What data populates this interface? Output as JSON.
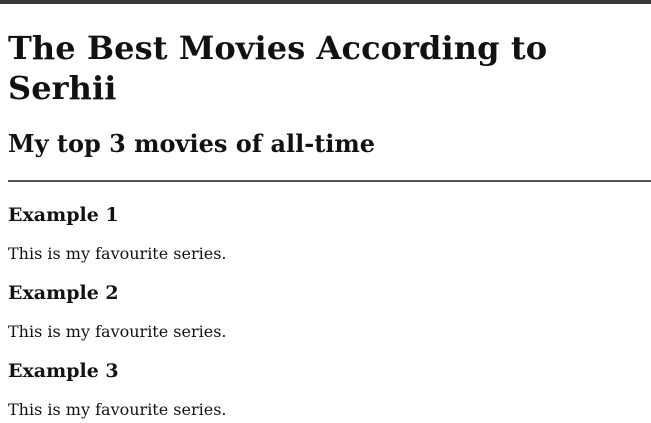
{
  "header": {
    "title": "The Best Movies According to Serhii",
    "subtitle": "My top 3 movies of all-time"
  },
  "movies": [
    {
      "title": "Example 1",
      "description": "This is my favourite series."
    },
    {
      "title": "Example 2",
      "description": "This is my favourite series."
    },
    {
      "title": "Example 3",
      "description": "This is my favourite series."
    }
  ]
}
